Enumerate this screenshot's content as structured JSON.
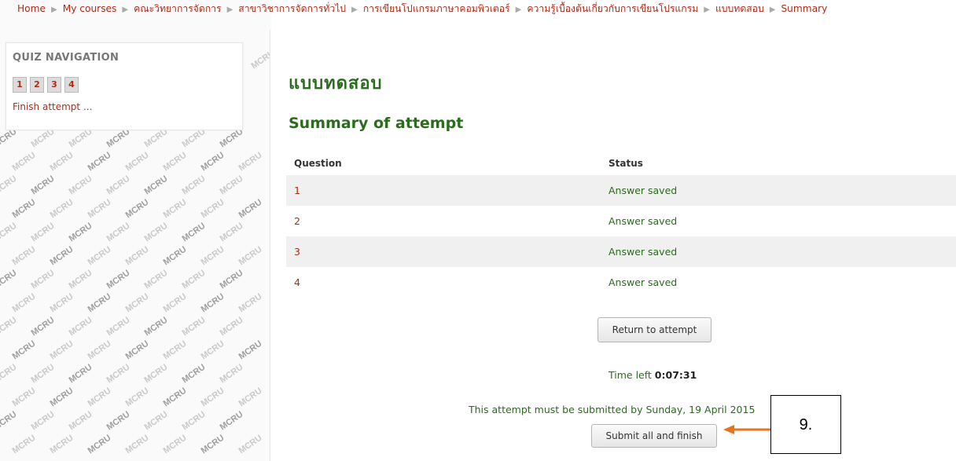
{
  "breadcrumb": {
    "items": [
      "Home",
      "My courses",
      "คณะวิทยาการจัดการ",
      "สาขาวิชาการจัดการทั่วไป",
      "การเขียนโปแกรมภาษาคอมพิวเตอร์",
      "ความรู้เบื้องต้นเกี่ยวกับการเขียนโปรแกรม",
      "แบบทดสอบ",
      "Summary"
    ],
    "separator": "▶"
  },
  "quiz_nav": {
    "title": "QUIZ NAVIGATION",
    "buttons": [
      "1",
      "2",
      "3",
      "4"
    ],
    "finish_link": "Finish attempt ..."
  },
  "main": {
    "title": "แบบทดสอบ",
    "summary_heading": "Summary of attempt",
    "table": {
      "headers": [
        "Question",
        "Status"
      ],
      "rows": [
        {
          "question": "1",
          "status": "Answer saved"
        },
        {
          "question": "2",
          "status": "Answer saved"
        },
        {
          "question": "3",
          "status": "Answer saved"
        },
        {
          "question": "4",
          "status": "Answer saved"
        }
      ]
    },
    "return_button": "Return to attempt",
    "time_left_label": "Time left",
    "time_left_value": "0:07:31",
    "deadline_text": "This attempt must be submitted by Sunday, 19 April 2015",
    "submit_button": "Submit all and finish"
  },
  "watermark_text": "MCRU",
  "annotation": {
    "label": "9."
  },
  "colors": {
    "link": "#b02a16",
    "heading_green": "#2b6b1e",
    "arrow": "#e8731c"
  }
}
